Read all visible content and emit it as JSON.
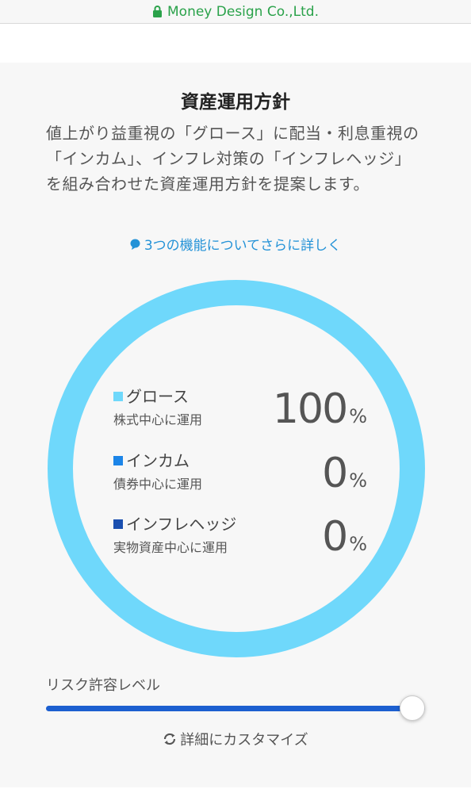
{
  "browser": {
    "domain": "Money Design Co.,Ltd.",
    "domain_color": "#2aa24a"
  },
  "section": {
    "title": "資産運用方針",
    "description": "値上がり益重視の「グロース」に配当・利息重視の「インカム」、インフレ対策の「インフレヘッジ」を組み合わせた資産運用方針を提案します。",
    "more_link": "3つの機能についてさらに詳しく"
  },
  "allocation": {
    "ring_color": "#6fd8fb",
    "items": [
      {
        "name": "グロース",
        "sub": "株式中心に運用",
        "percent": "100",
        "value": 100,
        "unit": "%",
        "color": "#6fd8fb"
      },
      {
        "name": "インカム",
        "sub": "債券中心に運用",
        "percent": "0",
        "value": 0,
        "unit": "%",
        "color": "#1c85e8"
      },
      {
        "name": "インフレヘッジ",
        "sub": "実物資産中心に運用",
        "percent": "0",
        "value": 0,
        "unit": "%",
        "color": "#1a4fb0"
      }
    ]
  },
  "risk": {
    "label": "リスク許容レベル",
    "level": 1.0,
    "color": "#1c5fd0"
  },
  "customize": {
    "label": "詳細にカスタマイズ"
  }
}
